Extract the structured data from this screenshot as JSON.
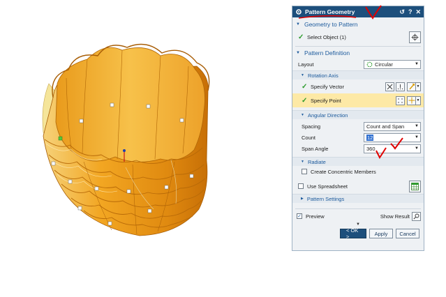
{
  "dialog": {
    "title": "Pattern Geometry",
    "reset_icon": "↺",
    "help_icon": "?",
    "close_icon": "✕"
  },
  "geometry_to_pattern": {
    "header": "Geometry to Pattern",
    "select_object_label": "Select Object (1)"
  },
  "pattern_definition": {
    "header": "Pattern Definition",
    "layout_label": "Layout",
    "layout_value": "Circular",
    "rotation_axis": {
      "header": "Rotation Axis",
      "specify_vector_label": "Specify Vector",
      "specify_point_label": "Specify Point"
    },
    "angular_direction": {
      "header": "Angular Direction",
      "spacing_label": "Spacing",
      "spacing_value": "Count and Span",
      "count_label": "Count",
      "count_value": "12",
      "span_angle_label": "Span Angle",
      "span_angle_value": "360",
      "span_angle_unit": "°"
    },
    "radiate": {
      "header": "Radiate",
      "create_concentric_label": "Create Concentric Members"
    },
    "use_spreadsheet_label": "Use Spreadsheet",
    "pattern_settings_header": "Pattern Settings"
  },
  "footer": {
    "preview_label": "Preview",
    "show_result_label": "Show Result",
    "ok_label": "< OK >",
    "apply_label": "Apply",
    "cancel_label": "Cancel"
  },
  "colors": {
    "accent": "#1d4f7c",
    "header_text": "#1c5a9c",
    "highlight_row": "#fde9a6",
    "body_orange": "#f2a623",
    "annotation_red": "#e00000"
  }
}
